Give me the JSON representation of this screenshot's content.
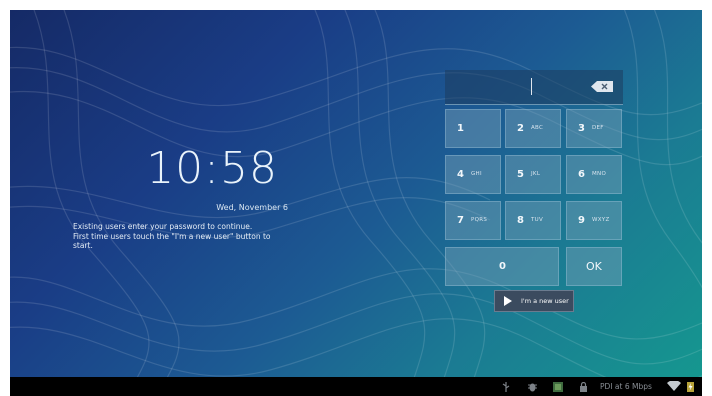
{
  "lock_screen": {
    "time": "10:58",
    "date": "Wed, November 6",
    "instructions": [
      "Existing users enter your password to continue.",
      "First time users touch the \"I'm a new user\" button to",
      "start."
    ]
  },
  "keypad": {
    "keys": [
      {
        "num": "1",
        "letters": ""
      },
      {
        "num": "2",
        "letters": "ABC"
      },
      {
        "num": "3",
        "letters": "DEF"
      },
      {
        "num": "4",
        "letters": "GHI"
      },
      {
        "num": "5",
        "letters": "JKL"
      },
      {
        "num": "6",
        "letters": "MNO"
      },
      {
        "num": "7",
        "letters": "PQRS"
      },
      {
        "num": "8",
        "letters": "TUV"
      },
      {
        "num": "9",
        "letters": "WXYZ"
      }
    ],
    "zero": "0",
    "ok": "OK",
    "backspace_icon": "backspace-icon"
  },
  "new_user_button": {
    "label": "I'm a new user",
    "icon": "play-icon"
  },
  "status_bar": {
    "network_text": "PDI at 6 Mbps",
    "icons": [
      "usb-icon",
      "debug-icon",
      "notification-icon",
      "lock-icon",
      "wifi-icon",
      "battery-charging-icon"
    ]
  },
  "colors": {
    "background_start": "#152a66",
    "background_end": "#15978f",
    "status_bar": "#000000"
  }
}
